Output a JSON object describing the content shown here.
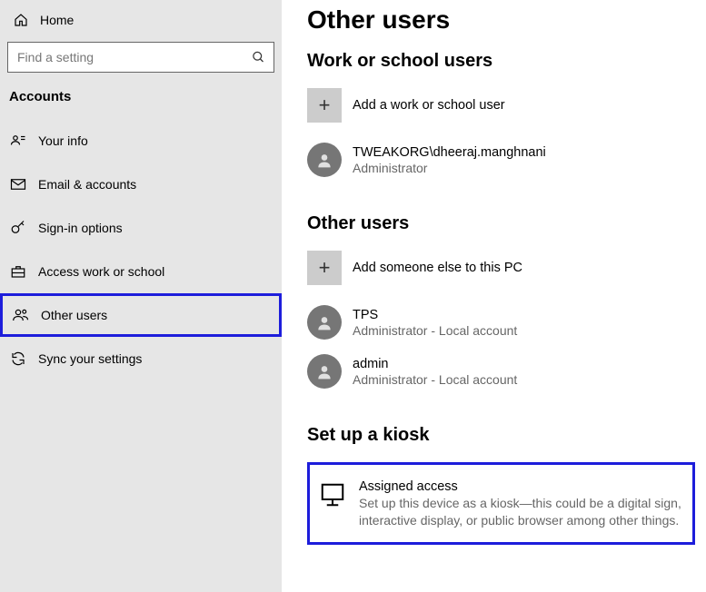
{
  "sidebar": {
    "home": "Home",
    "search_placeholder": "Find a setting",
    "section": "Accounts",
    "items": [
      {
        "label": "Your info"
      },
      {
        "label": "Email & accounts"
      },
      {
        "label": "Sign-in options"
      },
      {
        "label": "Access work or school"
      },
      {
        "label": "Other users"
      },
      {
        "label": "Sync your settings"
      }
    ]
  },
  "main": {
    "title": "Other users",
    "work_school": {
      "heading": "Work or school users",
      "add_label": "Add a work or school user",
      "users": [
        {
          "name": "TWEAKORG\\dheeraj.manghnani",
          "role": "Administrator"
        }
      ]
    },
    "other": {
      "heading": "Other users",
      "add_label": "Add someone else to this PC",
      "users": [
        {
          "name": "TPS",
          "role": "Administrator - Local account"
        },
        {
          "name": "admin",
          "role": "Administrator - Local account"
        }
      ]
    },
    "kiosk": {
      "heading": "Set up a kiosk",
      "title": "Assigned access",
      "desc": "Set up this device as a kiosk—this could be a digital sign, interactive display, or public browser among other things."
    }
  }
}
